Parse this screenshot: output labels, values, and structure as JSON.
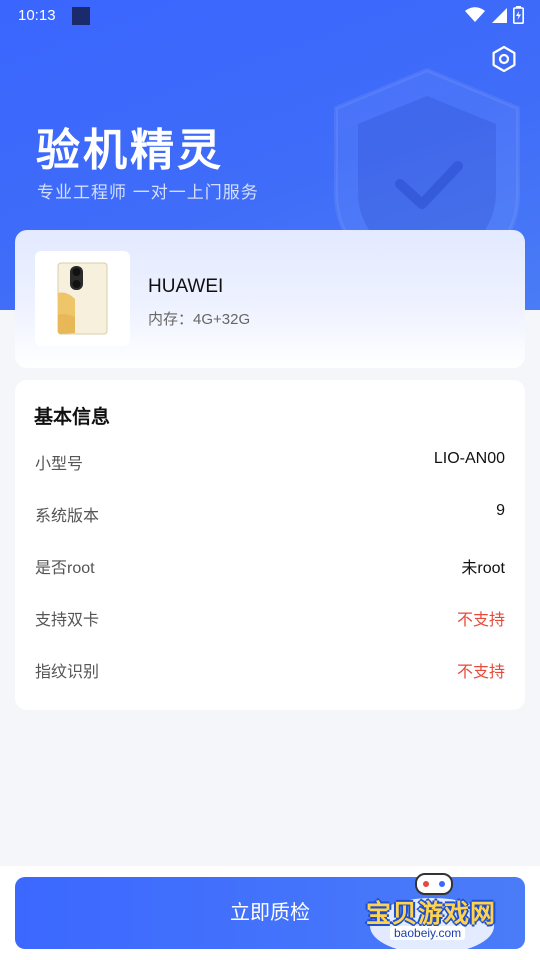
{
  "status_bar": {
    "time": "10:13",
    "icons": [
      "wifi-icon",
      "signal-icon",
      "battery-icon"
    ]
  },
  "header": {
    "title": "验机精灵",
    "subtitle": "专业工程师 一对一上门服务",
    "settings_icon": "settings-icon"
  },
  "device": {
    "brand": "HUAWEI",
    "memory": "内存：4G+32G"
  },
  "basic_info": {
    "title": "基本信息",
    "rows": [
      {
        "label": "小型号",
        "value": "LIO-AN00"
      },
      {
        "label": "系统版本",
        "value": "9"
      },
      {
        "label": "是否root",
        "value": "未root"
      },
      {
        "label": "支持双卡",
        "value": "不支持",
        "highlight": true
      },
      {
        "label": "指纹识别",
        "value": "不支持",
        "highlight": true
      }
    ]
  },
  "action": {
    "start_label": "立即质检"
  },
  "watermark": {
    "text": "宝贝游戏网",
    "url": "baobeiy.com"
  },
  "colors": {
    "primary": "#3c68ff",
    "warning": "#e64a3b",
    "background": "#f4f6f9"
  }
}
